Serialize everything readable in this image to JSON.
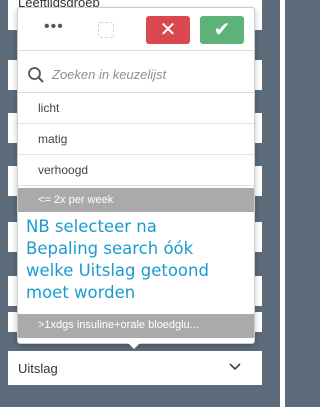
{
  "background_field_label": "Leeftijdsgroep",
  "toolbar": {
    "more_label": "•••",
    "cancel_label": "✕",
    "confirm_label": "✔"
  },
  "search": {
    "placeholder": "Zoeken in keuzelijst"
  },
  "options": [
    "licht",
    "matig",
    "verhoogd"
  ],
  "selected_option": "<= 2x per week",
  "bottom_option": ">1xdgs insuline+orale bloedglu...",
  "note": {
    "line1": "NB selecteer na",
    "line2": "Bepaling search óók",
    "line3": "welke Uitslag getoond",
    "line4": "moet worden"
  },
  "field": {
    "label": "Uitslag"
  },
  "colors": {
    "cancel": "#d9484c",
    "confirm": "#5cb278",
    "note_text": "#1a9bd0",
    "background": "#5c6c7b"
  }
}
